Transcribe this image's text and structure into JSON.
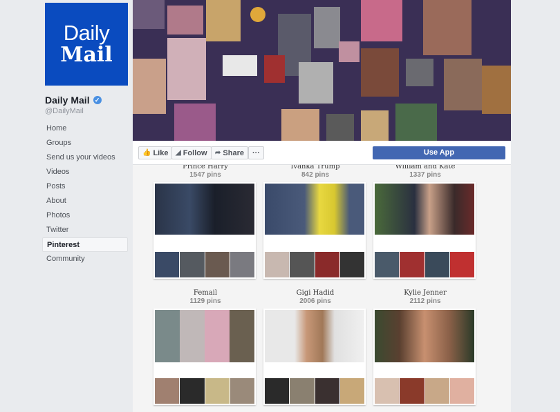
{
  "page": {
    "logo_line1": "Daily",
    "logo_line2": "Mail",
    "name": "Daily Mail",
    "handle": "@DailyMail",
    "verified_icon": "check-icon"
  },
  "nav": [
    {
      "label": "Home"
    },
    {
      "label": "Groups"
    },
    {
      "label": "Send us your videos"
    },
    {
      "label": "Videos"
    },
    {
      "label": "Posts"
    },
    {
      "label": "About"
    },
    {
      "label": "Photos"
    },
    {
      "label": "Twitter"
    },
    {
      "label": "Pinterest",
      "active": true
    },
    {
      "label": "Community"
    }
  ],
  "actions": {
    "like": "Like",
    "follow": "Follow",
    "share": "Share",
    "more": "···",
    "use_app": "Use App"
  },
  "boards": [
    {
      "title": "Prince Harry",
      "pins": "1547 pins"
    },
    {
      "title": "Ivanka Trump",
      "pins": "842 pins"
    },
    {
      "title": "William and Kate",
      "pins": "1337 pins"
    },
    {
      "title": "Femail",
      "pins": "1129 pins"
    },
    {
      "title": "Gigi Hadid",
      "pins": "2006 pins"
    },
    {
      "title": "Kylie Jenner",
      "pins": "2112 pins"
    }
  ],
  "colors": {
    "brand_blue": "#0a4bbf",
    "fb_blue": "#4267b2"
  }
}
